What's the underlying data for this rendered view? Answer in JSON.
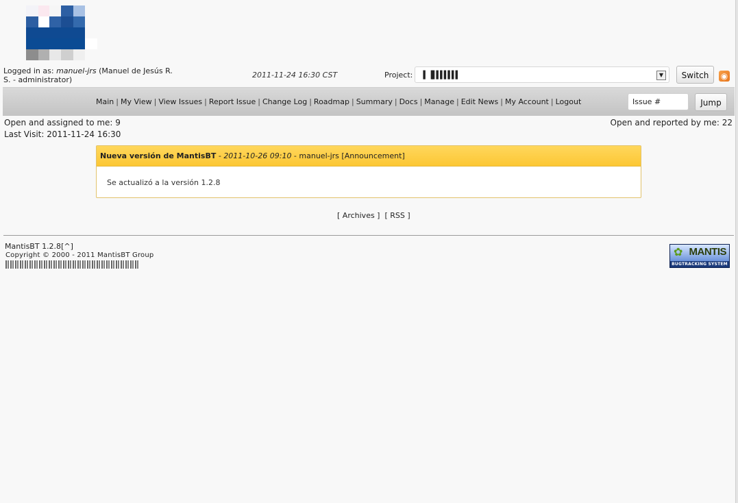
{
  "header": {
    "logged_in_label": "Logged in as:",
    "username": "manuel-jrs",
    "user_detail": "(Manuel de Jesús R. S. - administrator)",
    "datetime": "2011-11-24 16:30 CST",
    "project_label": "Project:",
    "project_value": "▐ ▐▌▌▌▌▌▌▌",
    "switch_label": "Switch",
    "rss_icon": "rss-icon"
  },
  "menu": {
    "items": [
      "Main",
      "My View",
      "View Issues",
      "Report Issue",
      "Change Log",
      "Roadmap",
      "Summary",
      "Docs",
      "Manage",
      "Edit News",
      "My Account",
      "Logout"
    ],
    "separator": "|",
    "issue_placeholder": "Issue #",
    "jump_label": "Jump"
  },
  "stats": {
    "assigned_label": "Open and assigned to me:",
    "assigned_count": "9",
    "reported_label": "Open and reported by me:",
    "reported_count": "22",
    "last_visit_label": "Last Visit:",
    "last_visit_value": "2011-11-24 16:30"
  },
  "news": {
    "title": "Nueva versión de MantisBT",
    "dash1": " - ",
    "date": "2011-10-26 09:10",
    "dash2": " - ",
    "author": "manuel-jrs",
    "category": "[Announcement]",
    "body": "Se actualizó a la versión 1.2.8",
    "archives_label": "Archives",
    "rss_label": "RSS"
  },
  "footer": {
    "version": "MantisBT 1.2.8",
    "top_link": "[^]",
    "copyright": "Copyright © 2000 - 2011 MantisBT Group",
    "logo_name": "MANTIS",
    "logo_tagline": "BUGTRACKING SYSTEM"
  },
  "colors": {
    "news_header": "#fcc734",
    "menubar": "#c8c8c8",
    "background": "#f8f8f8"
  }
}
